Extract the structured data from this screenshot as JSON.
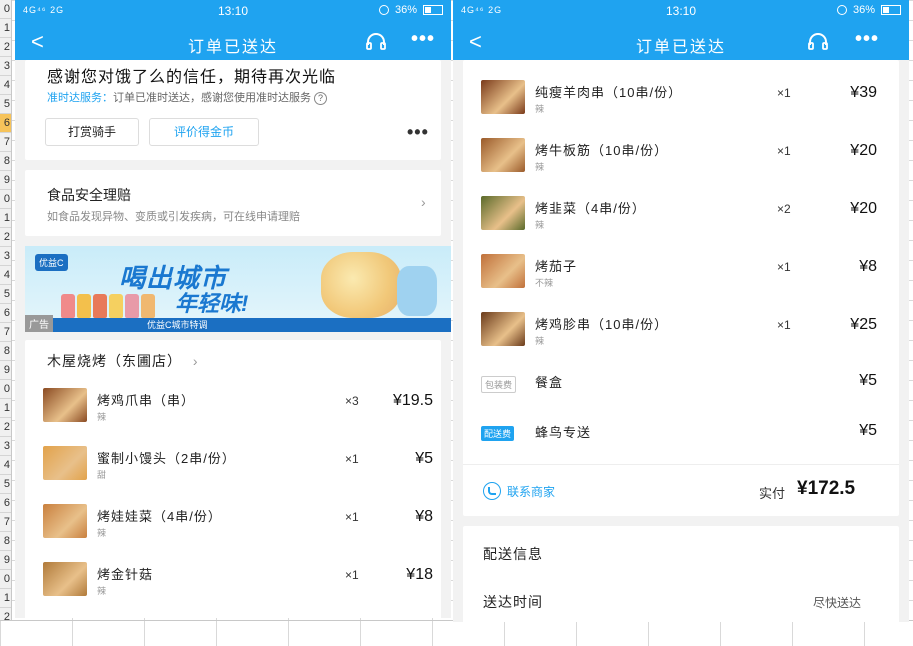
{
  "background": {
    "row_numbers": [
      "0",
      "1",
      "2",
      "3",
      "4",
      "5",
      "6",
      "7",
      "8",
      "9",
      "0",
      "1",
      "2",
      "3",
      "4",
      "5",
      "6",
      "7",
      "8",
      "9",
      "0",
      "1",
      "2",
      "3",
      "4",
      "5",
      "6",
      "7",
      "8",
      "9",
      "0",
      "1",
      "2"
    ],
    "selected_row_index": 6
  },
  "left": {
    "status": {
      "signal": "4G⁴⁶ 2G",
      "time": "13:10",
      "battery": "36%",
      "battery_level": 0.36
    },
    "nav": {
      "back": "<",
      "title": "订单已送达",
      "headset_icon": "headset-icon",
      "more": "•••"
    },
    "thanks": {
      "headline": "感谢您对饿了么的信任，期待再次光临",
      "ontime_tag": "准时达服务：",
      "ontime_text": "订单已准时送达，感谢您使用准时达服务",
      "help": "?",
      "tip_button": "打赏骑手",
      "review_button": "评价得金币",
      "more": "•••"
    },
    "food_safety": {
      "title": "食品安全理赔",
      "desc": "如食品发现异物、变质或引发疾病，可在线申请理赔",
      "chevron": "›"
    },
    "ad": {
      "slogan1": "喝出城市",
      "slogan2": "年轻味!",
      "brand": "优益C",
      "tag": "广告",
      "footer": "优益C城市特调"
    },
    "shop": {
      "name": "木屋烧烤（东圃店）",
      "chevron": "›"
    },
    "items": [
      {
        "name": "烤鸡爪串（串）",
        "sub": "辣",
        "qty": "×3",
        "price": "¥19.5",
        "color": "#8a4a22"
      },
      {
        "name": "蜜制小馒头（2串/份）",
        "sub": "甜",
        "qty": "×1",
        "price": "¥5",
        "color": "#e2a24b"
      },
      {
        "name": "烤娃娃菜（4串/份）",
        "sub": "辣",
        "qty": "×1",
        "price": "¥8",
        "color": "#c9803e"
      },
      {
        "name": "烤金针菇",
        "sub": "辣",
        "qty": "×1",
        "price": "¥18",
        "color": "#b07a3a"
      }
    ]
  },
  "right": {
    "status": {
      "signal": "4G⁴⁶ 2G",
      "time": "13:10",
      "battery": "36%",
      "battery_level": 0.36
    },
    "nav": {
      "back": "<",
      "title": "订单已送达",
      "headset_icon": "headset-icon",
      "more": "•••"
    },
    "items": [
      {
        "name": "纯瘦羊肉串（10串/份）",
        "sub": "辣",
        "qty": "×1",
        "price": "¥39",
        "color": "#7a3a1a"
      },
      {
        "name": "烤牛板筋（10串/份）",
        "sub": "辣",
        "qty": "×1",
        "price": "¥20",
        "color": "#9a5a2a"
      },
      {
        "name": "烤韭菜（4串/份）",
        "sub": "辣",
        "qty": "×2",
        "price": "¥20",
        "color": "#5a6a2a"
      },
      {
        "name": "烤茄子",
        "sub": "不辣",
        "qty": "×1",
        "price": "¥8",
        "color": "#c0703a"
      },
      {
        "name": "烤鸡胗串（10串/份）",
        "sub": "辣",
        "qty": "×1",
        "price": "¥25",
        "color": "#6a3a1a"
      }
    ],
    "packing": {
      "tag": "包装费",
      "label": "餐盒",
      "price": "¥5"
    },
    "delivery_fee": {
      "tag": "配送费",
      "label": "蜂鸟专送",
      "price": "¥5"
    },
    "contact_merchant": "联系商家",
    "total_label": "实付",
    "total_value": "¥172.5",
    "delivery_info": {
      "title": "配送信息",
      "time_key": "送达时间",
      "time_val": "尽快送达"
    }
  }
}
